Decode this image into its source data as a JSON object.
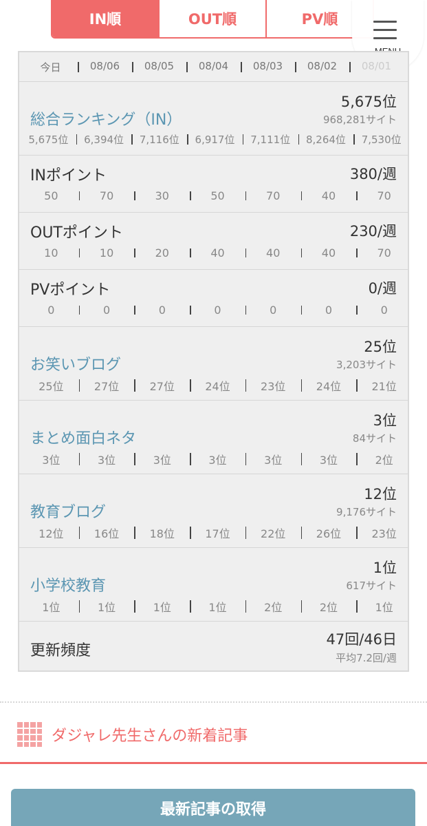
{
  "tabs": [
    {
      "label": "IN順",
      "active": true
    },
    {
      "label": "OUT順",
      "active": false
    },
    {
      "label": "PV順",
      "active": false
    }
  ],
  "menu": {
    "label": "MENU"
  },
  "dates": [
    "今日",
    "08/06",
    "08/05",
    "08/04",
    "08/03",
    "08/02",
    "08/01"
  ],
  "sections": {
    "overall": {
      "title": "総合ランキング（IN）",
      "rank": "5,675位",
      "sites": "968,281サイト",
      "history": [
        "5,675位",
        "6,394位",
        "7,116位",
        "6,917位",
        "7,111位",
        "8,264位",
        "7,530位"
      ]
    },
    "in_point": {
      "title": "INポイント",
      "value": "380/週",
      "history": [
        "50",
        "70",
        "30",
        "50",
        "70",
        "40",
        "70"
      ]
    },
    "out_point": {
      "title": "OUTポイント",
      "value": "230/週",
      "history": [
        "10",
        "10",
        "20",
        "40",
        "40",
        "40",
        "70"
      ]
    },
    "pv_point": {
      "title": "PVポイント",
      "value": "0/週",
      "history": [
        "0",
        "0",
        "0",
        "0",
        "0",
        "0",
        "0"
      ]
    },
    "owarai": {
      "title": "お笑いブログ",
      "rank": "25位",
      "sites": "3,203サイト",
      "history": [
        "25位",
        "27位",
        "27位",
        "24位",
        "23位",
        "24位",
        "21位"
      ]
    },
    "matome": {
      "title": "まとめ面白ネタ",
      "rank": "3位",
      "sites": "84サイト",
      "history": [
        "3位",
        "3位",
        "3位",
        "3位",
        "3位",
        "3位",
        "2位"
      ]
    },
    "kyouiku": {
      "title": "教育ブログ",
      "rank": "12位",
      "sites": "9,176サイト",
      "history": [
        "12位",
        "16位",
        "18位",
        "17位",
        "22位",
        "26位",
        "23位"
      ]
    },
    "shougakkou": {
      "title": "小学校教育",
      "rank": "1位",
      "sites": "617サイト",
      "history": [
        "1位",
        "1位",
        "1位",
        "1位",
        "2位",
        "2位",
        "1位"
      ]
    },
    "frequency": {
      "title": "更新頻度",
      "value": "47回/46日",
      "average": "平均7.2回/週"
    }
  },
  "articles": {
    "title": "ダジャレ先生さんの新着記事"
  },
  "fetch_button": {
    "label": "最新記事の取得"
  }
}
